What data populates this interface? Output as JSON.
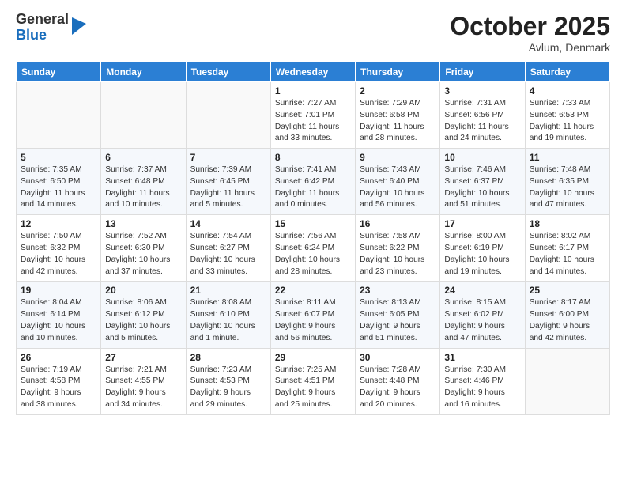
{
  "header": {
    "logo_general": "General",
    "logo_blue": "Blue",
    "month": "October 2025",
    "location": "Avlum, Denmark"
  },
  "days_of_week": [
    "Sunday",
    "Monday",
    "Tuesday",
    "Wednesday",
    "Thursday",
    "Friday",
    "Saturday"
  ],
  "weeks": [
    [
      {
        "day": "",
        "info": ""
      },
      {
        "day": "",
        "info": ""
      },
      {
        "day": "",
        "info": ""
      },
      {
        "day": "1",
        "info": "Sunrise: 7:27 AM\nSunset: 7:01 PM\nDaylight: 11 hours\nand 33 minutes."
      },
      {
        "day": "2",
        "info": "Sunrise: 7:29 AM\nSunset: 6:58 PM\nDaylight: 11 hours\nand 28 minutes."
      },
      {
        "day": "3",
        "info": "Sunrise: 7:31 AM\nSunset: 6:56 PM\nDaylight: 11 hours\nand 24 minutes."
      },
      {
        "day": "4",
        "info": "Sunrise: 7:33 AM\nSunset: 6:53 PM\nDaylight: 11 hours\nand 19 minutes."
      }
    ],
    [
      {
        "day": "5",
        "info": "Sunrise: 7:35 AM\nSunset: 6:50 PM\nDaylight: 11 hours\nand 14 minutes."
      },
      {
        "day": "6",
        "info": "Sunrise: 7:37 AM\nSunset: 6:48 PM\nDaylight: 11 hours\nand 10 minutes."
      },
      {
        "day": "7",
        "info": "Sunrise: 7:39 AM\nSunset: 6:45 PM\nDaylight: 11 hours\nand 5 minutes."
      },
      {
        "day": "8",
        "info": "Sunrise: 7:41 AM\nSunset: 6:42 PM\nDaylight: 11 hours\nand 0 minutes."
      },
      {
        "day": "9",
        "info": "Sunrise: 7:43 AM\nSunset: 6:40 PM\nDaylight: 10 hours\nand 56 minutes."
      },
      {
        "day": "10",
        "info": "Sunrise: 7:46 AM\nSunset: 6:37 PM\nDaylight: 10 hours\nand 51 minutes."
      },
      {
        "day": "11",
        "info": "Sunrise: 7:48 AM\nSunset: 6:35 PM\nDaylight: 10 hours\nand 47 minutes."
      }
    ],
    [
      {
        "day": "12",
        "info": "Sunrise: 7:50 AM\nSunset: 6:32 PM\nDaylight: 10 hours\nand 42 minutes."
      },
      {
        "day": "13",
        "info": "Sunrise: 7:52 AM\nSunset: 6:30 PM\nDaylight: 10 hours\nand 37 minutes."
      },
      {
        "day": "14",
        "info": "Sunrise: 7:54 AM\nSunset: 6:27 PM\nDaylight: 10 hours\nand 33 minutes."
      },
      {
        "day": "15",
        "info": "Sunrise: 7:56 AM\nSunset: 6:24 PM\nDaylight: 10 hours\nand 28 minutes."
      },
      {
        "day": "16",
        "info": "Sunrise: 7:58 AM\nSunset: 6:22 PM\nDaylight: 10 hours\nand 23 minutes."
      },
      {
        "day": "17",
        "info": "Sunrise: 8:00 AM\nSunset: 6:19 PM\nDaylight: 10 hours\nand 19 minutes."
      },
      {
        "day": "18",
        "info": "Sunrise: 8:02 AM\nSunset: 6:17 PM\nDaylight: 10 hours\nand 14 minutes."
      }
    ],
    [
      {
        "day": "19",
        "info": "Sunrise: 8:04 AM\nSunset: 6:14 PM\nDaylight: 10 hours\nand 10 minutes."
      },
      {
        "day": "20",
        "info": "Sunrise: 8:06 AM\nSunset: 6:12 PM\nDaylight: 10 hours\nand 5 minutes."
      },
      {
        "day": "21",
        "info": "Sunrise: 8:08 AM\nSunset: 6:10 PM\nDaylight: 10 hours\nand 1 minute."
      },
      {
        "day": "22",
        "info": "Sunrise: 8:11 AM\nSunset: 6:07 PM\nDaylight: 9 hours\nand 56 minutes."
      },
      {
        "day": "23",
        "info": "Sunrise: 8:13 AM\nSunset: 6:05 PM\nDaylight: 9 hours\nand 51 minutes."
      },
      {
        "day": "24",
        "info": "Sunrise: 8:15 AM\nSunset: 6:02 PM\nDaylight: 9 hours\nand 47 minutes."
      },
      {
        "day": "25",
        "info": "Sunrise: 8:17 AM\nSunset: 6:00 PM\nDaylight: 9 hours\nand 42 minutes."
      }
    ],
    [
      {
        "day": "26",
        "info": "Sunrise: 7:19 AM\nSunset: 4:58 PM\nDaylight: 9 hours\nand 38 minutes."
      },
      {
        "day": "27",
        "info": "Sunrise: 7:21 AM\nSunset: 4:55 PM\nDaylight: 9 hours\nand 34 minutes."
      },
      {
        "day": "28",
        "info": "Sunrise: 7:23 AM\nSunset: 4:53 PM\nDaylight: 9 hours\nand 29 minutes."
      },
      {
        "day": "29",
        "info": "Sunrise: 7:25 AM\nSunset: 4:51 PM\nDaylight: 9 hours\nand 25 minutes."
      },
      {
        "day": "30",
        "info": "Sunrise: 7:28 AM\nSunset: 4:48 PM\nDaylight: 9 hours\nand 20 minutes."
      },
      {
        "day": "31",
        "info": "Sunrise: 7:30 AM\nSunset: 4:46 PM\nDaylight: 9 hours\nand 16 minutes."
      },
      {
        "day": "",
        "info": ""
      }
    ]
  ]
}
